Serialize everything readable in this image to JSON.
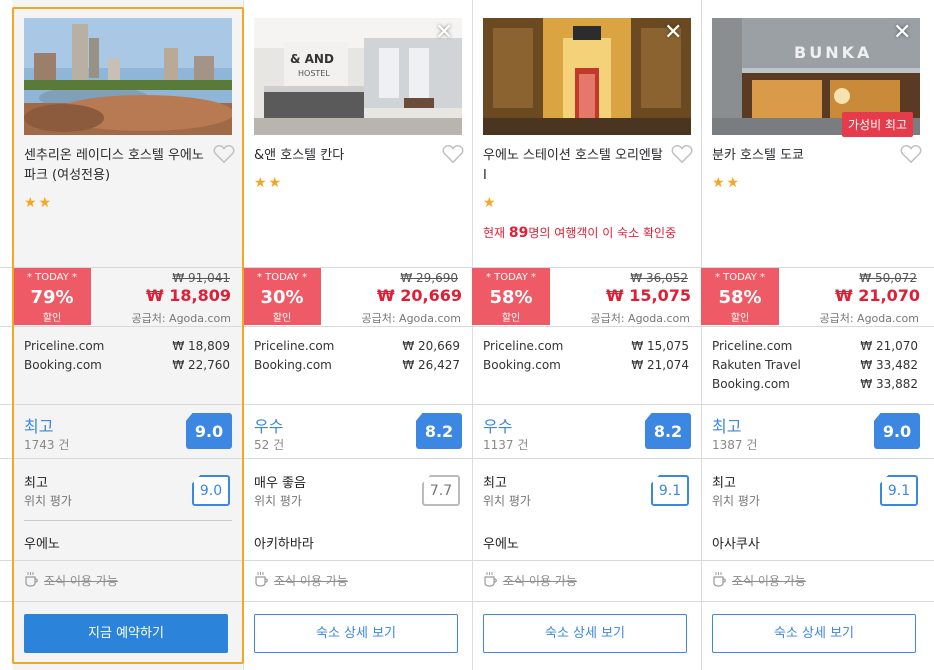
{
  "hotels": [
    {
      "name": "센추리온 레이디스 호스텔 우에노 파크 (여성전용)",
      "stars": "★★",
      "viewers_prefix": "",
      "viewers_count": "",
      "viewers_suffix": "",
      "today": "* TODAY *",
      "discount": "79%",
      "discount_label": "할인",
      "old_price": "₩ 91,041",
      "price": "₩ 18,809",
      "supplier": "공급처: Agoda.com",
      "offers": [
        {
          "site": "Priceline.com",
          "price": "₩ 18,809"
        },
        {
          "site": "Booking.com",
          "price": "₩ 22,760"
        }
      ],
      "rating_text": "최고",
      "review_count": "1743 건",
      "score": "9.0",
      "location_text": "최고",
      "location_sub": "위치 평가",
      "location_score": "9.0",
      "area": "우에노",
      "breakfast": "조식 이용 가능",
      "button": "지금 예약하기",
      "badge": "",
      "close": ""
    },
    {
      "name": "&앤 호스텔 칸다",
      "stars": "★★",
      "viewers_prefix": "",
      "viewers_count": "",
      "viewers_suffix": "",
      "today": "* TODAY *",
      "discount": "30%",
      "discount_label": "할인",
      "old_price": "₩ 29,690",
      "price": "₩ 20,669",
      "supplier": "공급처: Agoda.com",
      "offers": [
        {
          "site": "Priceline.com",
          "price": "₩ 20,669"
        },
        {
          "site": "Booking.com",
          "price": "₩ 26,427"
        }
      ],
      "rating_text": "우수",
      "review_count": "52 건",
      "score": "8.2",
      "location_text": "매우 좋음",
      "location_sub": "위치 평가",
      "location_score": "7.7",
      "area": "아키하바라",
      "breakfast": "조식 이용 가능",
      "button": "숙소 상세 보기",
      "badge": "",
      "close": "✕"
    },
    {
      "name": "우에노 스테이션 호스텔 오리엔탈 I",
      "stars": "★",
      "viewers_prefix": "현재 ",
      "viewers_count": "89",
      "viewers_suffix": "명의 여행객이 이 숙소 확인중",
      "today": "* TODAY *",
      "discount": "58%",
      "discount_label": "할인",
      "old_price": "₩ 36,052",
      "price": "₩ 15,075",
      "supplier": "공급처: Agoda.com",
      "offers": [
        {
          "site": "Priceline.com",
          "price": "₩ 15,075"
        },
        {
          "site": "Booking.com",
          "price": "₩ 21,074"
        }
      ],
      "rating_text": "우수",
      "review_count": "1137 건",
      "score": "8.2",
      "location_text": "최고",
      "location_sub": "위치 평가",
      "location_score": "9.1",
      "area": "우에노",
      "breakfast": "조식 이용 가능",
      "button": "숙소 상세 보기",
      "badge": "",
      "close": "✕"
    },
    {
      "name": "분카 호스텔 도쿄",
      "stars": "★★",
      "viewers_prefix": "",
      "viewers_count": "",
      "viewers_suffix": "",
      "today": "* TODAY *",
      "discount": "58%",
      "discount_label": "할인",
      "old_price": "₩ 50,072",
      "price": "₩ 21,070",
      "supplier": "공급처: Agoda.com",
      "offers": [
        {
          "site": "Priceline.com",
          "price": "₩ 21,070"
        },
        {
          "site": "Rakuten Travel",
          "price": "₩ 33,482"
        },
        {
          "site": "Booking.com",
          "price": "₩ 33,882"
        }
      ],
      "rating_text": "최고",
      "review_count": "1387 건",
      "score": "9.0",
      "location_text": "최고",
      "location_sub": "위치 평가",
      "location_score": "9.1",
      "area": "아사쿠사",
      "breakfast": "조식 이용 가능",
      "button": "숙소 상세 보기",
      "badge": "가성비 최고",
      "close": "✕"
    }
  ],
  "colors": {
    "accent": "#3b87e2",
    "deal": "#ee5b67",
    "price": "#e01e35",
    "star": "#f5a623",
    "highlight_border": "#f5a623"
  },
  "icons": {
    "heart": "heart-icon",
    "close": "close-icon",
    "breakfast": "coffee-cup-icon"
  }
}
